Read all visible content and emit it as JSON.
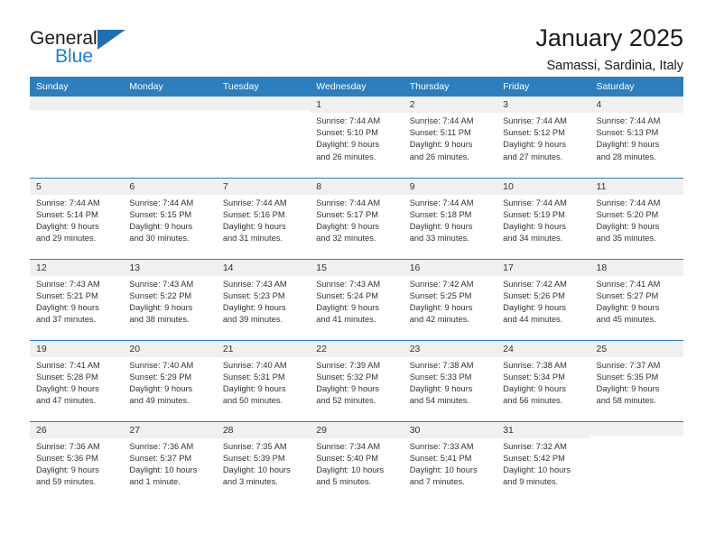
{
  "brand": {
    "name_top": "General",
    "name_bottom": "Blue",
    "triangle_color": "#1f6fb5",
    "blue_color": "#1f7fd0"
  },
  "header": {
    "title": "January 2025",
    "subtitle": "Samassi, Sardinia, Italy"
  },
  "theme": {
    "header_blue": "#2e7ebe",
    "daynum_bg": "#f0f0f0",
    "text": "#333333"
  },
  "weekdays": [
    "Sunday",
    "Monday",
    "Tuesday",
    "Wednesday",
    "Thursday",
    "Friday",
    "Saturday"
  ],
  "weeks": [
    [
      {
        "day": "",
        "empty": true,
        "sunrise": "",
        "sunset": "",
        "daylight_1": "",
        "daylight_2": ""
      },
      {
        "day": "",
        "empty": true,
        "sunrise": "",
        "sunset": "",
        "daylight_1": "",
        "daylight_2": ""
      },
      {
        "day": "",
        "empty": true,
        "sunrise": "",
        "sunset": "",
        "daylight_1": "",
        "daylight_2": ""
      },
      {
        "day": "1",
        "sunrise": "Sunrise: 7:44 AM",
        "sunset": "Sunset: 5:10 PM",
        "daylight_1": "Daylight: 9 hours",
        "daylight_2": "and 26 minutes."
      },
      {
        "day": "2",
        "sunrise": "Sunrise: 7:44 AM",
        "sunset": "Sunset: 5:11 PM",
        "daylight_1": "Daylight: 9 hours",
        "daylight_2": "and 26 minutes."
      },
      {
        "day": "3",
        "sunrise": "Sunrise: 7:44 AM",
        "sunset": "Sunset: 5:12 PM",
        "daylight_1": "Daylight: 9 hours",
        "daylight_2": "and 27 minutes."
      },
      {
        "day": "4",
        "sunrise": "Sunrise: 7:44 AM",
        "sunset": "Sunset: 5:13 PM",
        "daylight_1": "Daylight: 9 hours",
        "daylight_2": "and 28 minutes."
      }
    ],
    [
      {
        "day": "5",
        "sunrise": "Sunrise: 7:44 AM",
        "sunset": "Sunset: 5:14 PM",
        "daylight_1": "Daylight: 9 hours",
        "daylight_2": "and 29 minutes."
      },
      {
        "day": "6",
        "sunrise": "Sunrise: 7:44 AM",
        "sunset": "Sunset: 5:15 PM",
        "daylight_1": "Daylight: 9 hours",
        "daylight_2": "and 30 minutes."
      },
      {
        "day": "7",
        "sunrise": "Sunrise: 7:44 AM",
        "sunset": "Sunset: 5:16 PM",
        "daylight_1": "Daylight: 9 hours",
        "daylight_2": "and 31 minutes."
      },
      {
        "day": "8",
        "sunrise": "Sunrise: 7:44 AM",
        "sunset": "Sunset: 5:17 PM",
        "daylight_1": "Daylight: 9 hours",
        "daylight_2": "and 32 minutes."
      },
      {
        "day": "9",
        "sunrise": "Sunrise: 7:44 AM",
        "sunset": "Sunset: 5:18 PM",
        "daylight_1": "Daylight: 9 hours",
        "daylight_2": "and 33 minutes."
      },
      {
        "day": "10",
        "sunrise": "Sunrise: 7:44 AM",
        "sunset": "Sunset: 5:19 PM",
        "daylight_1": "Daylight: 9 hours",
        "daylight_2": "and 34 minutes."
      },
      {
        "day": "11",
        "sunrise": "Sunrise: 7:44 AM",
        "sunset": "Sunset: 5:20 PM",
        "daylight_1": "Daylight: 9 hours",
        "daylight_2": "and 35 minutes."
      }
    ],
    [
      {
        "day": "12",
        "sunrise": "Sunrise: 7:43 AM",
        "sunset": "Sunset: 5:21 PM",
        "daylight_1": "Daylight: 9 hours",
        "daylight_2": "and 37 minutes."
      },
      {
        "day": "13",
        "sunrise": "Sunrise: 7:43 AM",
        "sunset": "Sunset: 5:22 PM",
        "daylight_1": "Daylight: 9 hours",
        "daylight_2": "and 38 minutes."
      },
      {
        "day": "14",
        "sunrise": "Sunrise: 7:43 AM",
        "sunset": "Sunset: 5:23 PM",
        "daylight_1": "Daylight: 9 hours",
        "daylight_2": "and 39 minutes."
      },
      {
        "day": "15",
        "sunrise": "Sunrise: 7:43 AM",
        "sunset": "Sunset: 5:24 PM",
        "daylight_1": "Daylight: 9 hours",
        "daylight_2": "and 41 minutes."
      },
      {
        "day": "16",
        "sunrise": "Sunrise: 7:42 AM",
        "sunset": "Sunset: 5:25 PM",
        "daylight_1": "Daylight: 9 hours",
        "daylight_2": "and 42 minutes."
      },
      {
        "day": "17",
        "sunrise": "Sunrise: 7:42 AM",
        "sunset": "Sunset: 5:26 PM",
        "daylight_1": "Daylight: 9 hours",
        "daylight_2": "and 44 minutes."
      },
      {
        "day": "18",
        "sunrise": "Sunrise: 7:41 AM",
        "sunset": "Sunset: 5:27 PM",
        "daylight_1": "Daylight: 9 hours",
        "daylight_2": "and 45 minutes."
      }
    ],
    [
      {
        "day": "19",
        "sunrise": "Sunrise: 7:41 AM",
        "sunset": "Sunset: 5:28 PM",
        "daylight_1": "Daylight: 9 hours",
        "daylight_2": "and 47 minutes."
      },
      {
        "day": "20",
        "sunrise": "Sunrise: 7:40 AM",
        "sunset": "Sunset: 5:29 PM",
        "daylight_1": "Daylight: 9 hours",
        "daylight_2": "and 49 minutes."
      },
      {
        "day": "21",
        "sunrise": "Sunrise: 7:40 AM",
        "sunset": "Sunset: 5:31 PM",
        "daylight_1": "Daylight: 9 hours",
        "daylight_2": "and 50 minutes."
      },
      {
        "day": "22",
        "sunrise": "Sunrise: 7:39 AM",
        "sunset": "Sunset: 5:32 PM",
        "daylight_1": "Daylight: 9 hours",
        "daylight_2": "and 52 minutes."
      },
      {
        "day": "23",
        "sunrise": "Sunrise: 7:38 AM",
        "sunset": "Sunset: 5:33 PM",
        "daylight_1": "Daylight: 9 hours",
        "daylight_2": "and 54 minutes."
      },
      {
        "day": "24",
        "sunrise": "Sunrise: 7:38 AM",
        "sunset": "Sunset: 5:34 PM",
        "daylight_1": "Daylight: 9 hours",
        "daylight_2": "and 56 minutes."
      },
      {
        "day": "25",
        "sunrise": "Sunrise: 7:37 AM",
        "sunset": "Sunset: 5:35 PM",
        "daylight_1": "Daylight: 9 hours",
        "daylight_2": "and 58 minutes."
      }
    ],
    [
      {
        "day": "26",
        "sunrise": "Sunrise: 7:36 AM",
        "sunset": "Sunset: 5:36 PM",
        "daylight_1": "Daylight: 9 hours",
        "daylight_2": "and 59 minutes."
      },
      {
        "day": "27",
        "sunrise": "Sunrise: 7:36 AM",
        "sunset": "Sunset: 5:37 PM",
        "daylight_1": "Daylight: 10 hours",
        "daylight_2": "and 1 minute."
      },
      {
        "day": "28",
        "sunrise": "Sunrise: 7:35 AM",
        "sunset": "Sunset: 5:39 PM",
        "daylight_1": "Daylight: 10 hours",
        "daylight_2": "and 3 minutes."
      },
      {
        "day": "29",
        "sunrise": "Sunrise: 7:34 AM",
        "sunset": "Sunset: 5:40 PM",
        "daylight_1": "Daylight: 10 hours",
        "daylight_2": "and 5 minutes."
      },
      {
        "day": "30",
        "sunrise": "Sunrise: 7:33 AM",
        "sunset": "Sunset: 5:41 PM",
        "daylight_1": "Daylight: 10 hours",
        "daylight_2": "and 7 minutes."
      },
      {
        "day": "31",
        "sunrise": "Sunrise: 7:32 AM",
        "sunset": "Sunset: 5:42 PM",
        "daylight_1": "Daylight: 10 hours",
        "daylight_2": "and 9 minutes."
      },
      {
        "day": "",
        "empty": true,
        "sunrise": "",
        "sunset": "",
        "daylight_1": "",
        "daylight_2": ""
      }
    ]
  ]
}
